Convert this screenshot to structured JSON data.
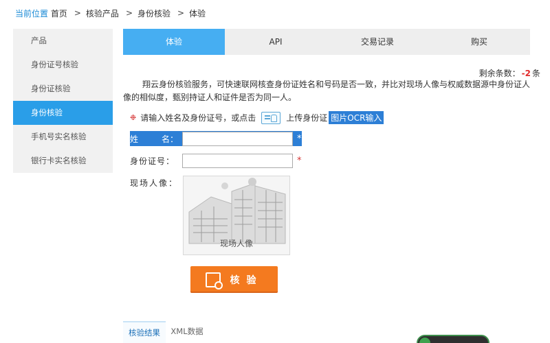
{
  "breadcrumb": {
    "label": "当前位置",
    "items": [
      "首页",
      "核验产品",
      "身份核验",
      "体验"
    ]
  },
  "sidebar": {
    "items": [
      {
        "label": "产品",
        "active": false
      },
      {
        "label": "身份证号核验",
        "active": false
      },
      {
        "label": "身份证核验",
        "active": false
      },
      {
        "label": "身份核验",
        "active": true
      },
      {
        "label": "手机号实名核验",
        "active": false
      },
      {
        "label": "银行卡实名核验",
        "active": false
      }
    ]
  },
  "tabs": [
    {
      "label": "体验",
      "active": true
    },
    {
      "label": "API",
      "active": false
    },
    {
      "label": "交易记录",
      "active": false
    },
    {
      "label": "购买",
      "active": false
    }
  ],
  "remaining": {
    "label": "剩余条数：",
    "value": "-2",
    "unit": "条"
  },
  "description": "翔云身份核验服务，可快速联网核查身份证姓名和号码是否一致，并比对现场人像与权威数据源中身份证人像的相似度，甄别持证人和证件是否为同一人。",
  "hint": {
    "symbol": "❉",
    "text_before": "请输入姓名及身份证号，或点击",
    "text_after": "上传身份证",
    "ocr_link": "图片OCR输入"
  },
  "form": {
    "name_label_1": "姓",
    "name_label_2": "名：",
    "name_value": "",
    "id_label": "身份证号：",
    "id_value": "",
    "photo_label": "现场人像：",
    "photo_caption": "现场人像",
    "required_mark": "*"
  },
  "verify_button": "核验",
  "bottom_tabs": [
    {
      "label": "核验结果",
      "active": true
    },
    {
      "label": "XML数据",
      "active": false
    }
  ],
  "colors": {
    "accent": "#2a9ee8",
    "tab_active": "#46aef2",
    "button": "#f47a1f",
    "required": "#d53434",
    "selection": "#2d7fd6"
  }
}
